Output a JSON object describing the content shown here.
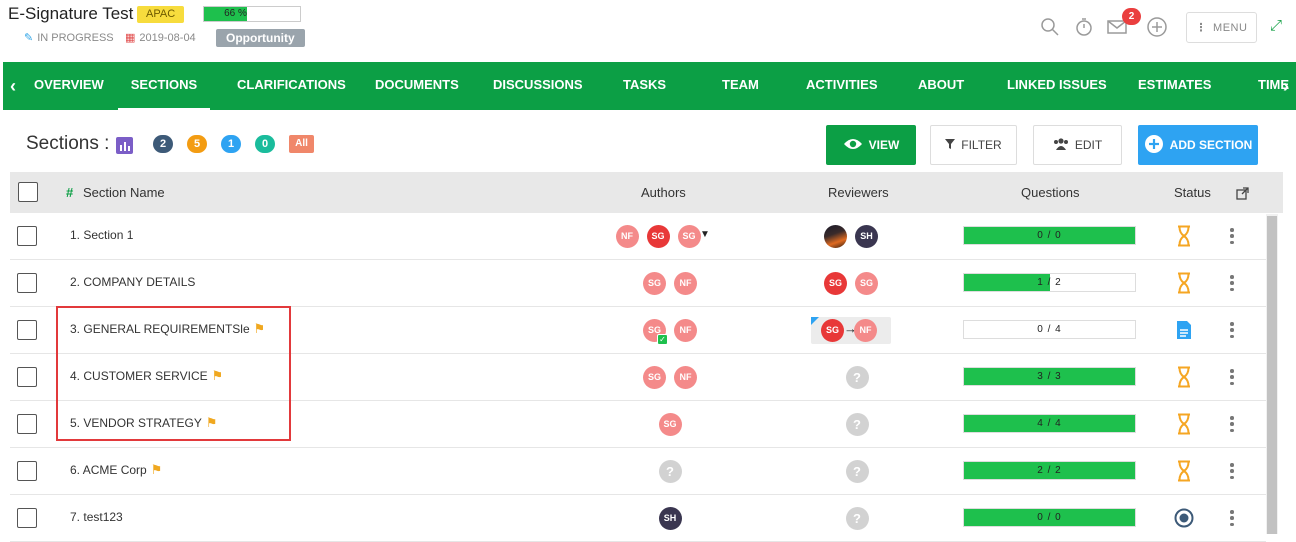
{
  "header": {
    "title": "E-Signature Test",
    "region": "APAC",
    "progress": {
      "label": "66 %",
      "percent": 66
    },
    "status": "IN PROGRESS",
    "date": "2019-08-04",
    "type": "Opportunity",
    "notification_count": "2",
    "menu_label": "MENU"
  },
  "nav": {
    "tabs": [
      "OVERVIEW",
      "SECTIONS",
      "CLARIFICATIONS",
      "DOCUMENTS",
      "DISCUSSIONS",
      "TASKS",
      "TEAM",
      "ACTIVITIES",
      "ABOUT",
      "LINKED ISSUES",
      "ESTIMATES",
      "TIME"
    ],
    "active": "SECTIONS"
  },
  "toolbar": {
    "label": "Sections :",
    "counts": [
      {
        "value": "2",
        "color": "#3d5a78"
      },
      {
        "value": "5",
        "color": "#f39c12"
      },
      {
        "value": "1",
        "color": "#2ea3f2"
      },
      {
        "value": "0",
        "color": "#1abc9c"
      },
      {
        "value": "All",
        "color": "#f0876a"
      }
    ],
    "view_label": "VIEW",
    "filter_label": "FILTER",
    "edit_label": "EDIT",
    "add_label": "ADD SECTION"
  },
  "table": {
    "headers": {
      "name": "Section Name",
      "authors": "Authors",
      "reviewers": "Reviewers",
      "questions": "Questions",
      "status": "Status"
    },
    "rows": [
      {
        "num": "1.",
        "name": "Section 1",
        "flag": false,
        "authors": [
          {
            "i": "NF",
            "c": "pink"
          },
          {
            "i": "SG",
            "c": "red"
          },
          {
            "i": "SG",
            "c": "pink"
          }
        ],
        "authors_more": true,
        "reviewers": [
          {
            "i": "",
            "c": "photo"
          },
          {
            "i": "SH",
            "c": "dark"
          }
        ],
        "questions": "0 / 0",
        "q_fill": 1.0,
        "status": "hourglass"
      },
      {
        "num": "2.",
        "name": "COMPANY DETAILS",
        "flag": false,
        "authors": [
          {
            "i": "SG",
            "c": "pink"
          },
          {
            "i": "NF",
            "c": "pink"
          }
        ],
        "reviewers": [
          {
            "i": "SG",
            "c": "red"
          },
          {
            "i": "SG",
            "c": "pink"
          }
        ],
        "questions": "1 / 2",
        "q_fill": 0.5,
        "status": "hourglass"
      },
      {
        "num": "3.",
        "name": "GENERAL REQUIREMENTSle",
        "flag": true,
        "authors": [
          {
            "i": "SG",
            "c": "pink",
            "check": true
          },
          {
            "i": "NF",
            "c": "pink"
          }
        ],
        "reviewers_transfer": [
          {
            "i": "SG",
            "c": "red"
          },
          {
            "i": "NF",
            "c": "pink"
          }
        ],
        "questions": "0 / 4",
        "q_fill": 0,
        "status": "document"
      },
      {
        "num": "4.",
        "name": "CUSTOMER SERVICE",
        "flag": true,
        "authors": [
          {
            "i": "SG",
            "c": "pink"
          },
          {
            "i": "NF",
            "c": "pink"
          }
        ],
        "reviewers": [
          {
            "i": "?",
            "c": "q"
          }
        ],
        "questions": "3 / 3",
        "q_fill": 1.0,
        "status": "hourglass"
      },
      {
        "num": "5.",
        "name": "VENDOR STRATEGY",
        "flag": true,
        "authors": [
          {
            "i": "SG",
            "c": "pink"
          }
        ],
        "reviewers": [
          {
            "i": "?",
            "c": "q"
          }
        ],
        "questions": "4 / 4",
        "q_fill": 1.0,
        "status": "hourglass"
      },
      {
        "num": "6.",
        "name": "ACME Corp",
        "flag": true,
        "authors": [
          {
            "i": "?",
            "c": "q"
          }
        ],
        "reviewers": [
          {
            "i": "?",
            "c": "q"
          }
        ],
        "questions": "2 / 2",
        "q_fill": 1.0,
        "status": "hourglass"
      },
      {
        "num": "7.",
        "name": "test123",
        "flag": false,
        "authors": [
          {
            "i": "SH",
            "c": "dark"
          }
        ],
        "reviewers": [
          {
            "i": "?",
            "c": "q"
          }
        ],
        "questions": "0 / 0",
        "q_fill": 1.0,
        "status": "target"
      }
    ]
  }
}
